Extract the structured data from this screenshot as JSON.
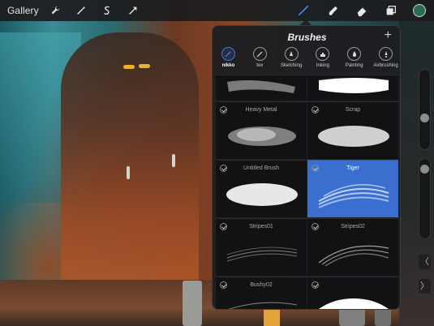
{
  "toolbar": {
    "gallery_label": "Gallery",
    "left_tools": [
      {
        "icon": "wrench-icon"
      },
      {
        "icon": "magic-wand-icon"
      },
      {
        "icon": "selection-icon"
      },
      {
        "icon": "transform-arrow-icon"
      }
    ],
    "right_tools": [
      {
        "icon": "brush-icon",
        "active": true
      },
      {
        "icon": "smudge-icon"
      },
      {
        "icon": "eraser-icon"
      },
      {
        "icon": "layers-icon"
      }
    ],
    "color": "#2e6b55"
  },
  "brushes_panel": {
    "title": "Brushes",
    "add_icon": "plus-icon",
    "categories": [
      {
        "label": "nikko",
        "icon": "pen-icon",
        "active": true
      },
      {
        "label": "tex",
        "icon": "brush-icon"
      },
      {
        "label": "Sketching",
        "icon": "pencil-icon"
      },
      {
        "label": "Inking",
        "icon": "ink-icon"
      },
      {
        "label": "Painting",
        "icon": "paint-icon"
      },
      {
        "label": "Airbrushing",
        "icon": "airbrush-icon"
      }
    ],
    "brushes": [
      {
        "name": "",
        "selected": false
      },
      {
        "name": "",
        "selected": false
      },
      {
        "name": "Heavy Metal",
        "selected": false
      },
      {
        "name": "Scrap",
        "selected": false
      },
      {
        "name": "Untitled Brush",
        "selected": false
      },
      {
        "name": "Tiger",
        "selected": true
      },
      {
        "name": "Stripes01",
        "selected": false
      },
      {
        "name": "Stripes02",
        "selected": false
      },
      {
        "name": "Bushy02",
        "selected": false
      },
      {
        "name": "",
        "selected": false
      }
    ],
    "accent_color": "#3a6fd0"
  },
  "sidebar": {
    "undo_label": "〈",
    "redo_label": "〉"
  }
}
